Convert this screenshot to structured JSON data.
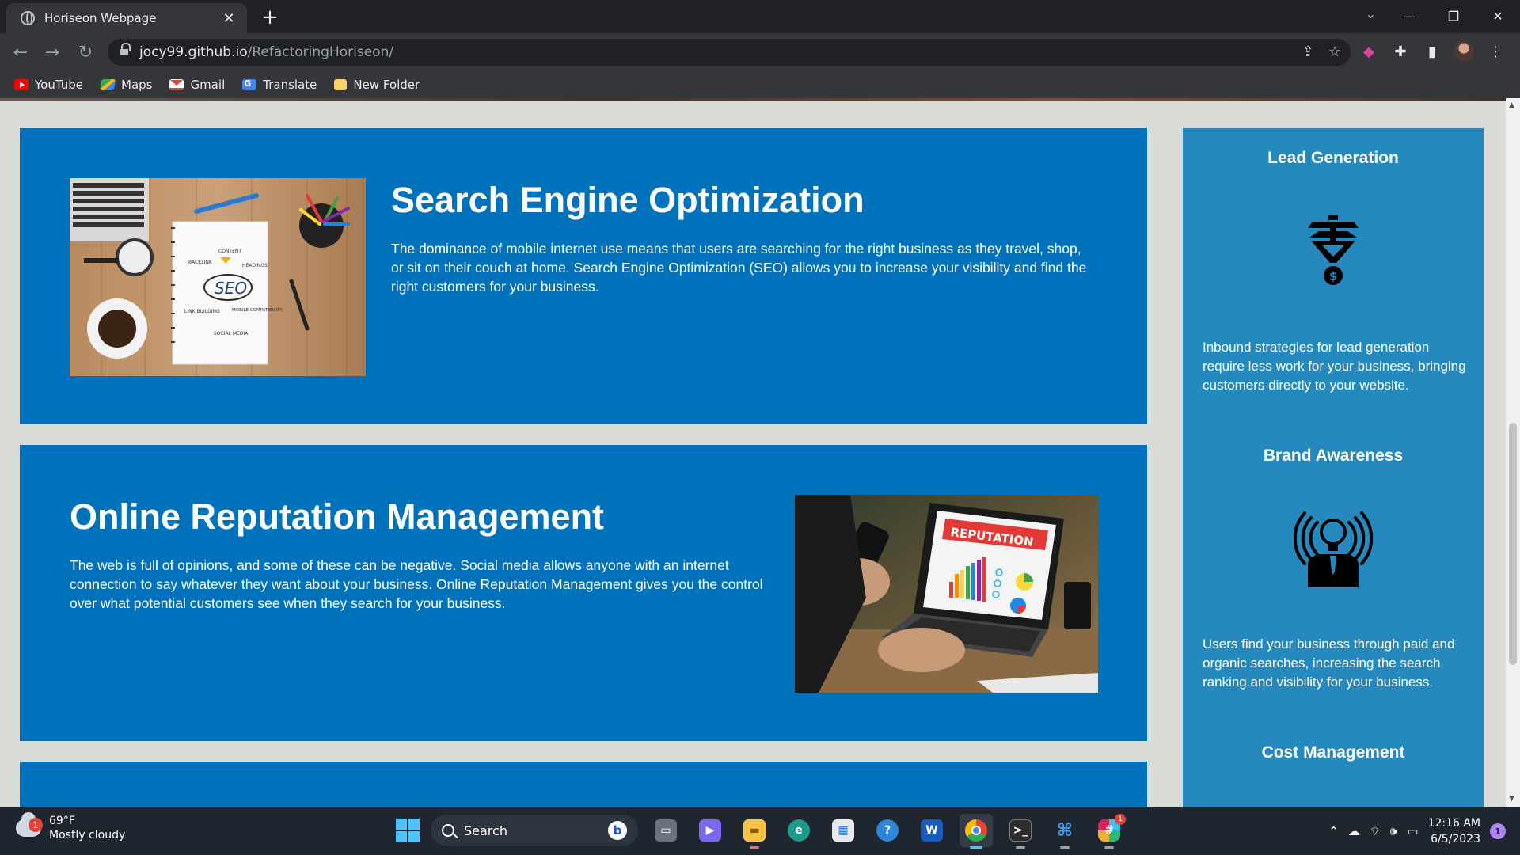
{
  "browser": {
    "tab_title": "Horiseon Webpage",
    "new_tab_symbol": "+",
    "url_host": "jocy99.github.io",
    "url_path": "/RefactoringHoriseon/",
    "bookmarks": [
      {
        "label": "YouTube",
        "icon": "youtube-icon"
      },
      {
        "label": "Maps",
        "icon": "maps-icon"
      },
      {
        "label": "Gmail",
        "icon": "gmail-icon"
      },
      {
        "label": "Translate",
        "icon": "translate-icon"
      },
      {
        "label": "New Folder",
        "icon": "folder-icon"
      }
    ]
  },
  "page": {
    "colors": {
      "card_bg": "#0072bb",
      "aside_bg": "#2589bd",
      "page_bg": "#d9dcd6",
      "text": "#ffffff"
    },
    "sections": [
      {
        "id": "search-engine-optimization",
        "title": "Search Engine Optimization",
        "text": "The dominance of mobile internet use means that users are searching for the right business as they travel, shop, or sit on their couch at home. Search Engine Optimization (SEO) allows you to increase your visibility and find the right customers for your business.",
        "image_labels": [
          "CONTENT",
          "BACKLINK",
          "HEADINGS",
          "SEO",
          "LINK BUILDING",
          "MOBILE COMPATIBILITY",
          "SOCIAL MEDIA"
        ]
      },
      {
        "id": "online-reputation-management",
        "title": "Online Reputation Management",
        "text": "The web is full of opinions, and some of these can be negative. Social media allows anyone with an internet connection to say whatever they want about your business. Online Reputation Management gives you the control over what potential customers see when they search for your business.",
        "image_labels": [
          "REPUTATION"
        ]
      }
    ],
    "benefits": [
      {
        "title": "Lead Generation",
        "icon": "lead-generation-funnel-icon",
        "text": "Inbound strategies for lead generation require less work for your business, bringing customers directly to your website."
      },
      {
        "title": "Brand Awareness",
        "icon": "brand-awareness-lightbulb-icon",
        "text": "Users find your business through paid and organic searches, increasing the search ranking and visibility for your business."
      },
      {
        "title": "Cost Management",
        "icon": "",
        "text": ""
      }
    ]
  },
  "taskbar": {
    "weather_temp": "69°F",
    "weather_desc": "Mostly cloudy",
    "weather_badge": "1",
    "search_label": "Search",
    "slack_badge": "1",
    "time": "12:16 AM",
    "date": "6/5/2023",
    "notification_count": "1"
  }
}
